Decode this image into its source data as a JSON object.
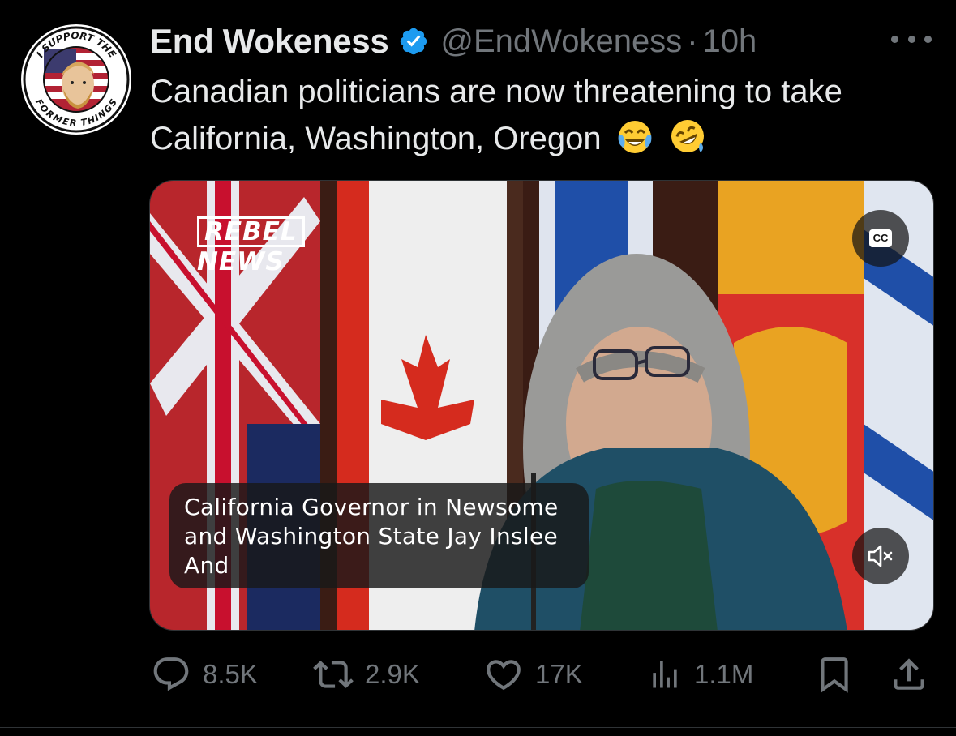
{
  "author": {
    "name": "End Wokeness",
    "handle": "@EndWokeness",
    "separator": "·",
    "time": "10h",
    "avatar_top_text": "I SUPPORT THE",
    "avatar_bottom_text": "FORMER THINGS"
  },
  "tweet": {
    "text": "Canadian politicians are now threatening to take California, Washington, Oregon",
    "emojis": [
      "face-with-tears-of-joy-icon",
      "rolling-on-floor-laughing-icon"
    ]
  },
  "media": {
    "watermark_line1": "REBEL",
    "watermark_line2": "NEWS",
    "cc_label": "CC",
    "caption": " California Governor in Newsome\nand Washington State Jay Inslee\nAnd"
  },
  "actions": {
    "replies": "8.5K",
    "reposts": "2.9K",
    "likes": "17K",
    "views": "1.1M"
  },
  "colors": {
    "background": "#000000",
    "text": "#e7e9ea",
    "secondary": "#71767b",
    "verified": "#1d9bf0"
  }
}
